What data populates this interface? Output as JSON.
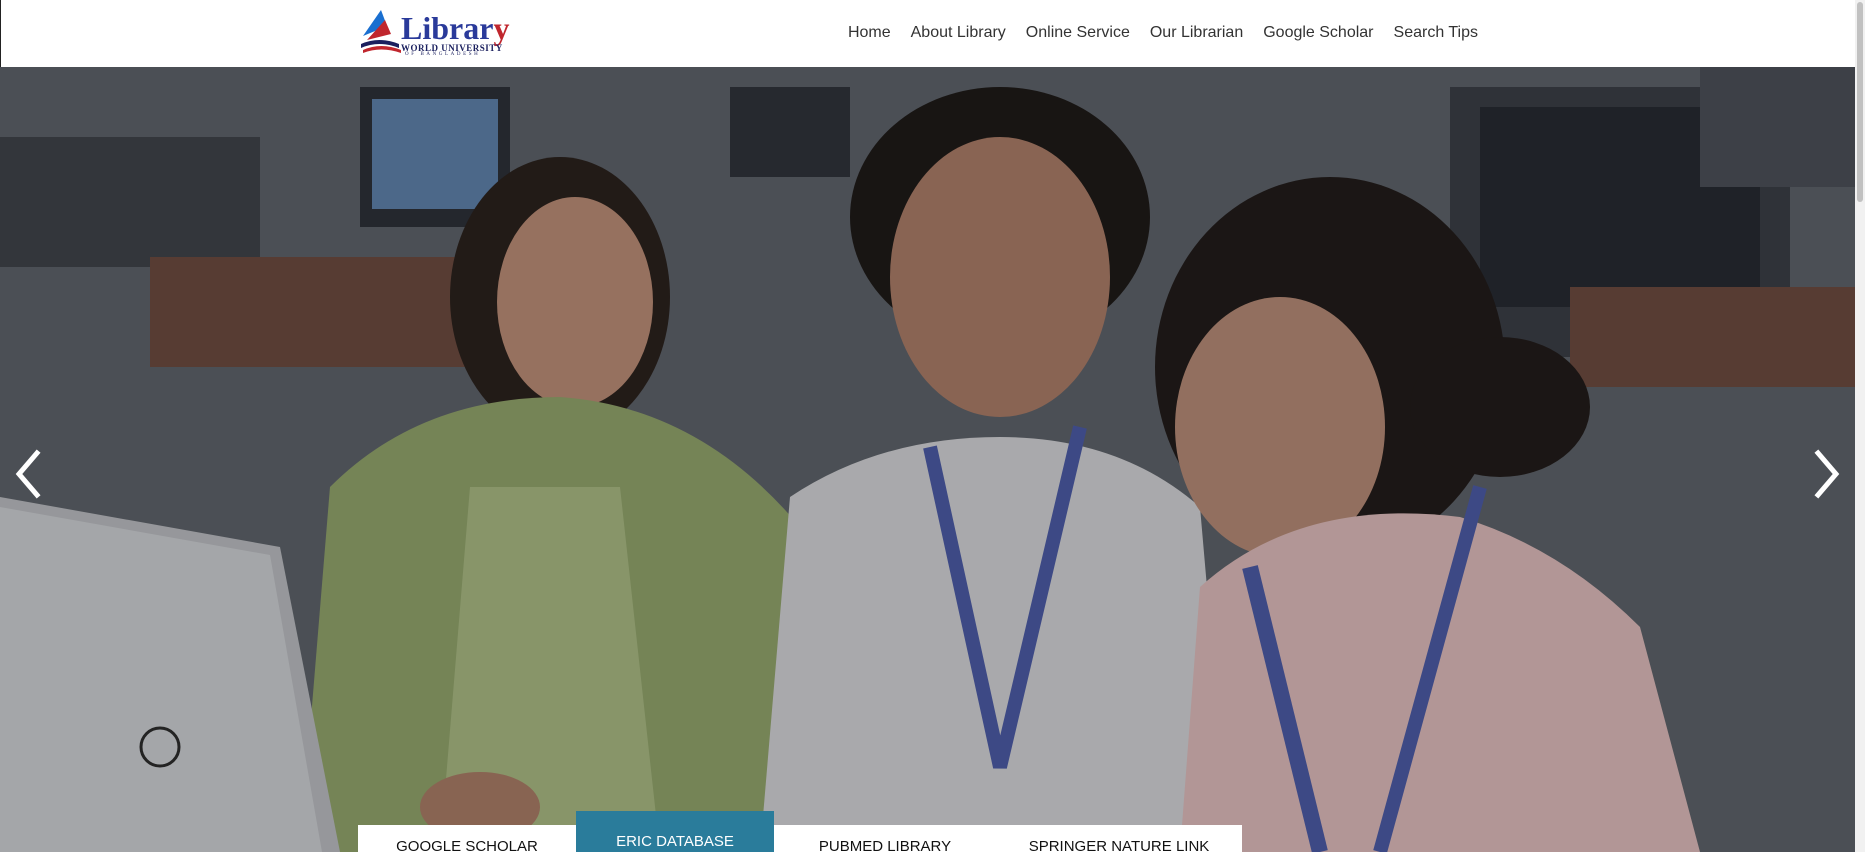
{
  "logo": {
    "title_main": "Librar",
    "title_end": "y",
    "subtitle": "WORLD UNIVERSITY",
    "subtitle_small": "OF BANGLADESH"
  },
  "nav": {
    "items": [
      {
        "label": "Home"
      },
      {
        "label": "About Library"
      },
      {
        "label": "Online Service"
      },
      {
        "label": "Our Librarian"
      },
      {
        "label": "Google Scholar"
      },
      {
        "label": "Search Tips"
      }
    ]
  },
  "hero": {
    "prev_icon": "chevron-left-icon",
    "next_icon": "chevron-right-icon"
  },
  "tabs": {
    "items": [
      {
        "label": "GOOGLE SCHOLAR"
      },
      {
        "label": "ERIC DATABASE"
      },
      {
        "label": "PUBMED LIBRARY"
      },
      {
        "label": "SPRINGER NATURE LINK"
      }
    ],
    "active_index": 1
  },
  "colors": {
    "accent": "#2a7c9b",
    "nav_text": "#333333",
    "logo_blue": "#2a3a9a",
    "logo_red": "#c0262d"
  }
}
